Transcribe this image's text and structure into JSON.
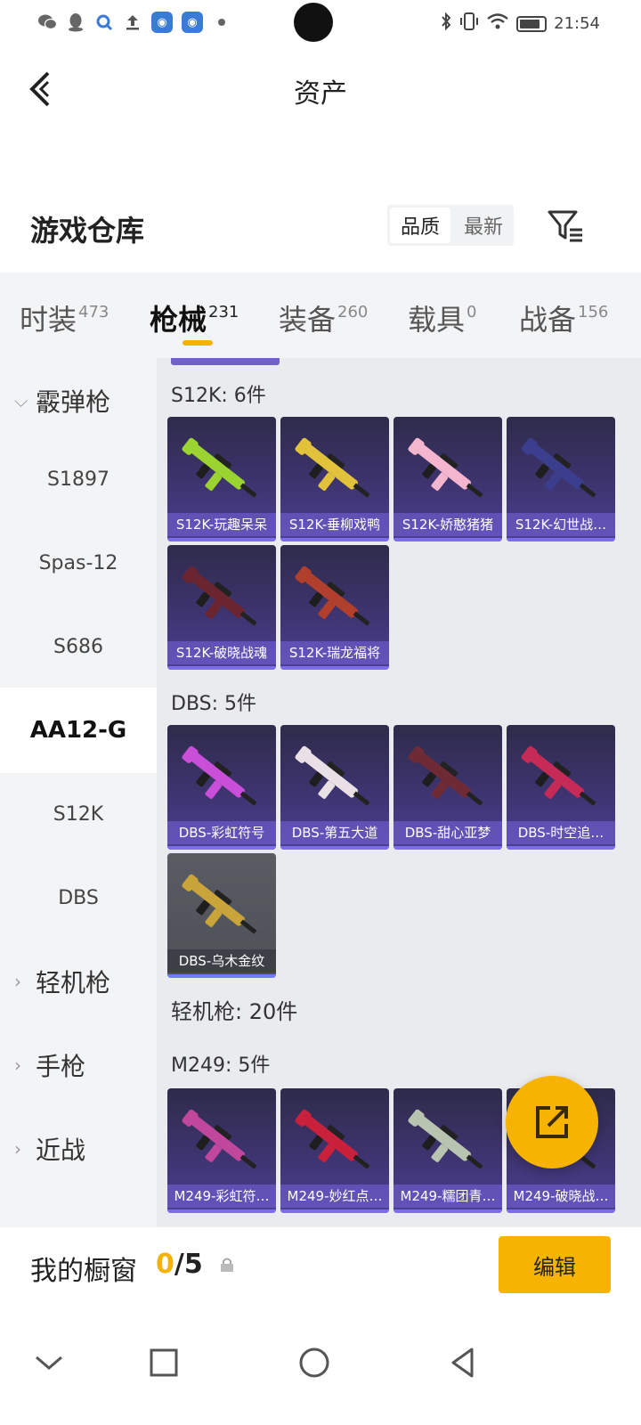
{
  "status_bar": {
    "time": "21:54",
    "left_icons": [
      "wechat-icon",
      "qq-icon",
      "search-app-icon",
      "upload-icon",
      "app-icon",
      "app-icon",
      "dot-icon"
    ],
    "right_icons": [
      "bluetooth-icon",
      "vibrate-icon",
      "wifi-icon",
      "battery-icon"
    ]
  },
  "header": {
    "title": "资产",
    "back_icon": "chevron-left-icon"
  },
  "warehouse": {
    "title": "游戏仓库",
    "sort_options": [
      "品质",
      "最新"
    ],
    "active_sort": "品质",
    "filter_icon": "filter-icon"
  },
  "tabs": [
    {
      "label": "时装",
      "count": "473"
    },
    {
      "label": "枪械",
      "count": "231"
    },
    {
      "label": "装备",
      "count": "260"
    },
    {
      "label": "载具",
      "count": "0"
    },
    {
      "label": "战备",
      "count": "156"
    }
  ],
  "active_tab": "枪械",
  "sidenav": {
    "items": [
      "霰弹枪",
      "S1897",
      "Spas-12",
      "S686",
      "AA12-G",
      "S12K",
      "DBS",
      "轻机枪",
      "手枪",
      "近战"
    ],
    "active": "AA12-G"
  },
  "sections": [
    {
      "title": "S12K: 6件",
      "items": [
        "S12K-玩趣呆呆",
        "S12K-垂柳戏鸭",
        "S12K-娇憨猪猪",
        "S12K-幻世战…",
        "S12K-破晓战魂",
        "S12K-瑞龙福将"
      ]
    },
    {
      "title": "DBS: 5件",
      "items": [
        "DBS-彩虹符号",
        "DBS-第五大道",
        "DBS-甜心亚梦",
        "DBS-时空追…",
        "DBS-乌木金纹"
      ]
    },
    {
      "title": "轻机枪: 20件",
      "items": []
    },
    {
      "title": "M249: 5件",
      "items": [
        "M249-彩虹符…",
        "M249-妙红点…",
        "M249-糯团青…",
        "M249-破晓战…"
      ]
    }
  ],
  "gun_colors": {
    "S12K-玩趣呆呆": "#9bd431",
    "S12K-垂柳戏鸭": "#e2c23a",
    "S12K-娇憨猪猪": "#f4b6cf",
    "S12K-幻世战…": "#3a3e8c",
    "S12K-破晓战魂": "#6b2530",
    "S12K-瑞龙福将": "#b0402c",
    "DBS-彩虹符号": "#c94fd8",
    "DBS-第五大道": "#e8e0e4",
    "DBS-甜心亚梦": "#6e2a35",
    "DBS-时空追…": "#c62a56",
    "DBS-乌木金纹": "#c8a43a",
    "M249-彩虹符…": "#c0479c",
    "M249-妙红点…": "#c9213b",
    "M249-糯团青…": "#b9c4b0",
    "M249-破晓战…": "#2a2a33"
  },
  "footer": {
    "showcase_label": "我的橱窗",
    "showcase_used": "0",
    "showcase_total": "/5",
    "edit_label": "编辑"
  },
  "accent_color": "#f6b400"
}
